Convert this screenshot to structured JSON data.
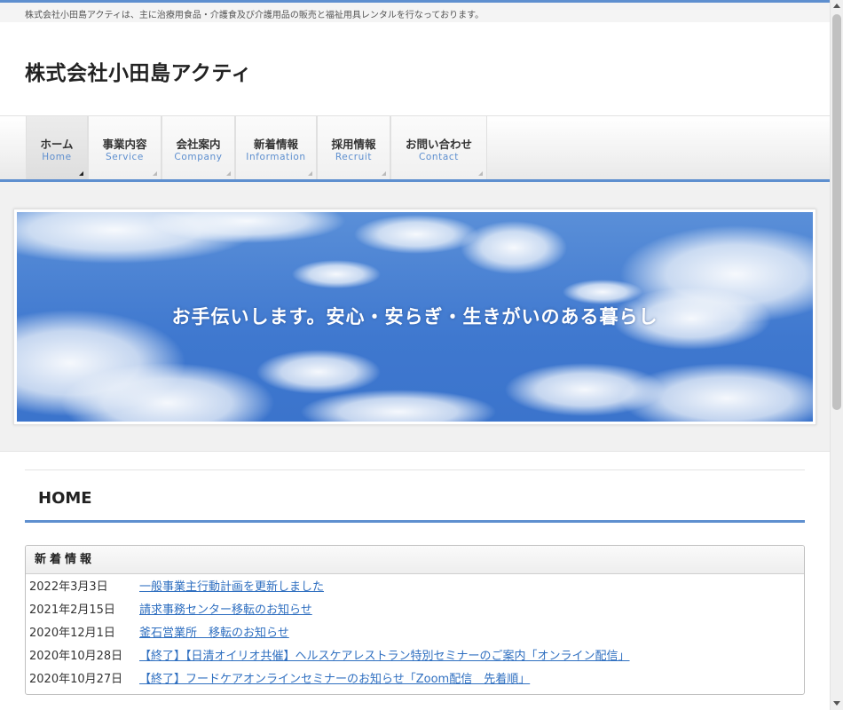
{
  "header": {
    "tagline": "株式会社小田島アクティは、主に治療用食品・介護食及び介護用品の販売と福祉用具レンタルを行なっております。",
    "site_title": "株式会社小田島アクティ"
  },
  "nav": {
    "items": [
      {
        "label": "ホーム",
        "sub": "Home",
        "active": true
      },
      {
        "label": "事業内容",
        "sub": "Service",
        "active": false
      },
      {
        "label": "会社案内",
        "sub": "Company",
        "active": false
      },
      {
        "label": "新着情報",
        "sub": "Information",
        "active": false
      },
      {
        "label": "採用情報",
        "sub": "Recruit",
        "active": false
      },
      {
        "label": "お問い合わせ",
        "sub": "Contact",
        "active": false
      }
    ]
  },
  "hero": {
    "text": "お手伝いします。安心・安らぎ・生きがいのある暮らし"
  },
  "main": {
    "page_title": "HOME",
    "news": {
      "heading": "新着情報",
      "items": [
        {
          "date": "2022年3月3日",
          "title": "一般事業主行動計画を更新しました"
        },
        {
          "date": "2021年2月15日",
          "title": "請求事務センター移転のお知らせ"
        },
        {
          "date": "2020年12月1日",
          "title": "釜石営業所　移転のお知らせ"
        },
        {
          "date": "2020年10月28日",
          "title": "【終了】【日清オイリオ共催】ヘルスケアレストラン特別セミナーのご案内「オンライン配信」"
        },
        {
          "date": "2020年10月27日",
          "title": "【終了】フードケアオンラインセミナーのお知らせ「Zoom配信　先着順」"
        }
      ]
    }
  },
  "colors": {
    "accent": "#5e8fcf",
    "link": "#2f6fc0"
  }
}
